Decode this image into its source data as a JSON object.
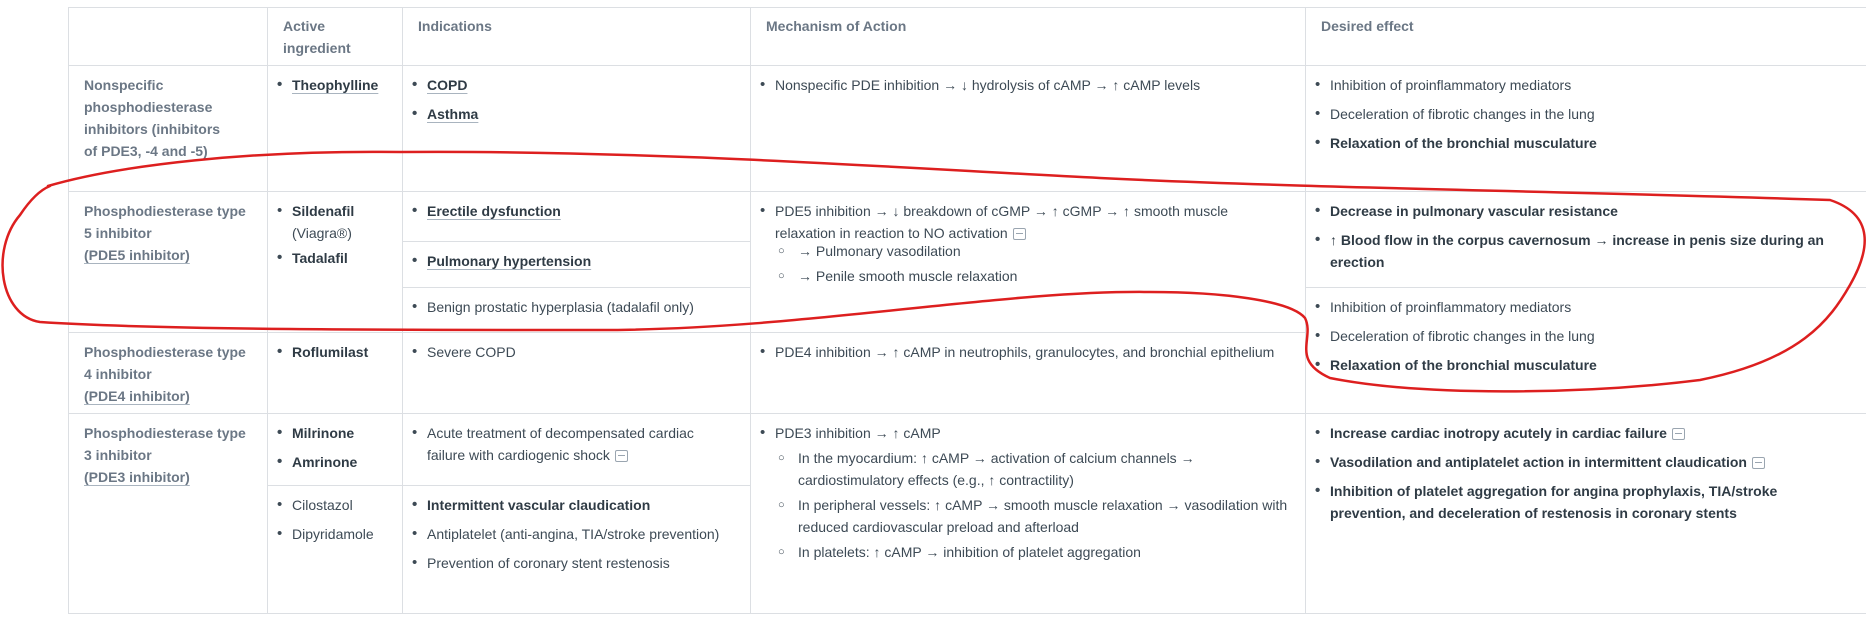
{
  "headers": {
    "col1": "Active ingredient",
    "col2": "Indications",
    "col3": "Mechanism of Action",
    "col4": "Desired effect"
  },
  "rows": {
    "nonspecific": {
      "title": "Nonspecific phosphodiesterase inhibitors (inhibitors of PDE3, -4 and -5)",
      "ingredient": "Theophylline",
      "indications": [
        "COPD",
        "Asthma"
      ],
      "mechanism": "Nonspecific PDE inhibition → ↓ hydrolysis of cAMP → ↑ cAMP levels",
      "effects": [
        "Inhibition of proinflammatory mediators",
        "Deceleration of fibrotic changes in the lung",
        "Relaxation of the bronchial musculature"
      ]
    },
    "pde5": {
      "title_line1": "Phosphodiesterase type",
      "title_line2": "5 inhibitor",
      "title_line3": "(PDE5 inhibitor)",
      "ingredient1": "Sildenafil",
      "ingredient1_brand": "(Viagra®)",
      "ingredient2": "Tadalafil",
      "indications": [
        "Erectile dysfunction",
        "Pulmonary hypertension",
        "Benign prostatic hyperplasia (tadalafil only)"
      ],
      "mechanism_line1": "PDE5 inhibition → ↓ breakdown of cGMP → ↑ cGMP → ↑ smooth muscle",
      "mechanism_line2": "relaxation in reaction to NO activation",
      "mechanism_sub": [
        "→ Pulmonary vasodilation",
        "→ Penile smooth muscle relaxation"
      ],
      "effects": [
        "Decrease in pulmonary vascular resistance",
        "↑ Blood flow in the corpus cavernosum → increase in penis size during an erection"
      ]
    },
    "pde4": {
      "title_line1": "Phosphodiesterase type",
      "title_line2": "4 inhibitor",
      "title_line3": "(PDE4 inhibitor)",
      "ingredient": "Roflumilast",
      "indications": [
        "Severe COPD"
      ],
      "mechanism": "PDE4 inhibition → ↑ cAMP in neutrophils, granulocytes, and bronchial epithelium",
      "effects": [
        "Inhibition of proinflammatory mediators",
        "Deceleration of fibrotic changes in the lung",
        "Relaxation of the bronchial musculature"
      ]
    },
    "pde3": {
      "title_line1": "Phosphodiesterase type",
      "title_line2": "3 inhibitor",
      "title_line3": "(PDE3 inhibitor)",
      "ingredients_a": [
        "Milrinone",
        "Amrinone"
      ],
      "ingredients_b": [
        "Cilostazol",
        "Dipyridamole"
      ],
      "indications_a": "Acute treatment of decompensated cardiac failure with cardiogenic shock",
      "indications_b": [
        "Intermittent vascular claudication",
        "Antiplatelet (anti-angina, TIA/stroke prevention)",
        "Prevention of coronary stent restenosis"
      ],
      "mechanism": "PDE3 inhibition → ↑ cAMP",
      "mechanism_sub": [
        "In the myocardium: ↑ cAMP → activation of calcium channels → cardiostimulatory effects (e.g., ↑ contractility)",
        "In peripheral vessels: ↑ cAMP → smooth muscle relaxation → vasodilation with reduced cardiovascular preload and afterload",
        "In platelets: ↑ cAMP → inhibition of platelet aggregation"
      ],
      "effects": [
        "Increase cardiac inotropy acutely in cardiac failure",
        "Vasodilation and antiplatelet action in intermittent claudication",
        "Inhibition of platelet aggregation for angina prophylaxis, TIA/stroke prevention, and deceleration of restenosis in coronary stents"
      ]
    }
  },
  "annotation": {
    "color": "#dd1f1f"
  }
}
